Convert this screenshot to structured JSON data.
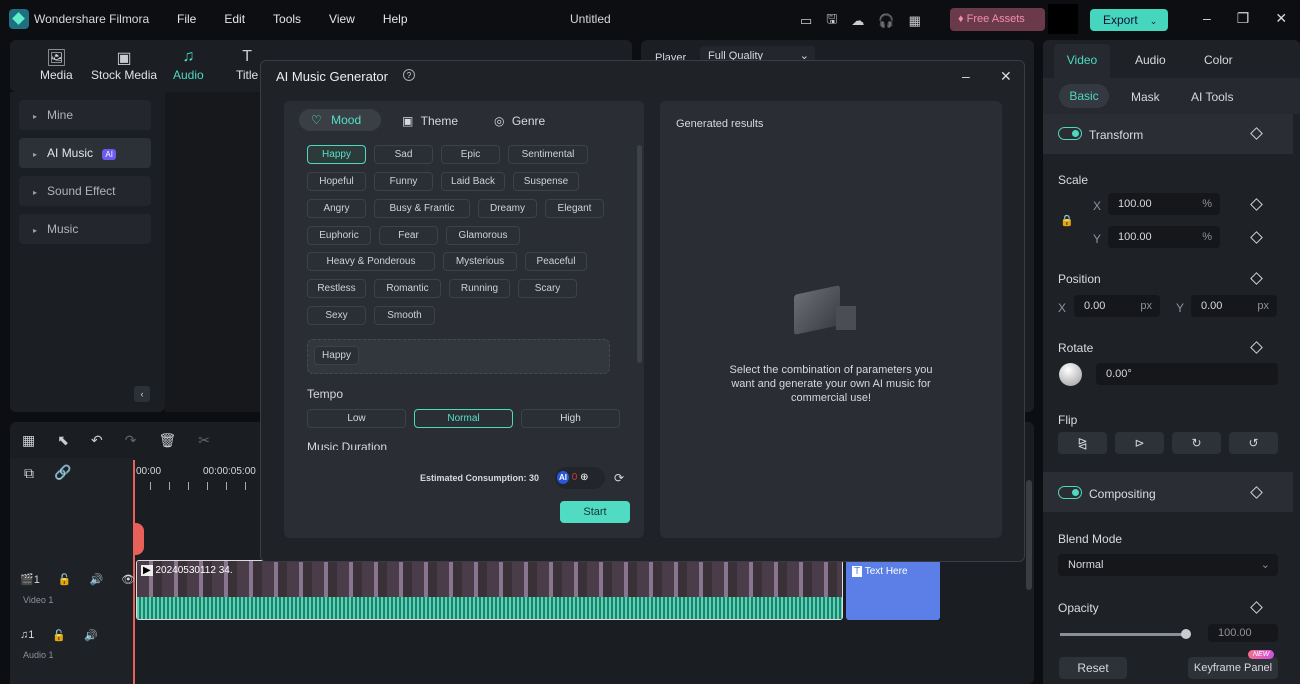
{
  "app": {
    "name": "Wondershare Filmora",
    "title": "Untitled",
    "menu": [
      "File",
      "Edit",
      "Tools",
      "View",
      "Help"
    ],
    "free_assets": "Free Assets",
    "export": "Export"
  },
  "toolbar": {
    "items": [
      "Media",
      "Stock Media",
      "Audio",
      "Title"
    ],
    "active": "Audio"
  },
  "sidebar": {
    "items": [
      "Mine",
      "AI Music",
      "Sound Effect",
      "Music"
    ],
    "ai_badge": "AI"
  },
  "player": {
    "label": "Player",
    "quality": "Full Quality"
  },
  "dialog": {
    "title": "AI Music Generator",
    "tabs": [
      "Mood",
      "Theme",
      "Genre"
    ],
    "active_tab": "Mood",
    "moods": [
      "Happy",
      "Sad",
      "Epic",
      "Sentimental",
      "Hopeful",
      "Funny",
      "Laid Back",
      "Suspense",
      "Angry",
      "Busy & Frantic",
      "Dreamy",
      "Elegant",
      "Euphoric",
      "Fear",
      "Glamorous",
      "Heavy & Ponderous",
      "Mysterious",
      "Peaceful",
      "Restless",
      "Romantic",
      "Running",
      "Scary",
      "Sexy",
      "Smooth"
    ],
    "selected_mood": "Happy",
    "selected_chip": "Happy",
    "tempo_label": "Tempo",
    "tempo": [
      "Low",
      "Normal",
      "High"
    ],
    "tempo_selected": "Normal",
    "duration_label": "Music Duration",
    "consumption": "Estimated Consumption: 30",
    "credits": "0",
    "credit_badge": "AI",
    "start": "Start",
    "results_title": "Generated results",
    "empty_text": "Select the combination of parameters you want and generate your own AI music for commercial use!"
  },
  "timeline": {
    "times": [
      "00:00",
      "00:00:05:00"
    ],
    "video_track": "Video 1",
    "audio_track": "Audio 1",
    "track_num": "1",
    "clip_name": "20240530112 34.",
    "text_clip": "Text Here"
  },
  "inspector": {
    "tabs": [
      "Video",
      "Audio",
      "Color"
    ],
    "subtabs": [
      "Basic",
      "Mask",
      "AI Tools"
    ],
    "transform": "Transform",
    "scale": "Scale",
    "scale_x": "100.00",
    "scale_y": "100.00",
    "pct": "%",
    "x": "X",
    "y": "Y",
    "position": "Position",
    "pos_x": "0.00",
    "pos_y": "0.00",
    "px": "px",
    "rotate": "Rotate",
    "rotate_val": "0.00°",
    "flip": "Flip",
    "compositing": "Compositing",
    "blend_mode": "Blend Mode",
    "blend_val": "Normal",
    "opacity": "Opacity",
    "opacity_val": "100.00",
    "opacity_level": 100,
    "reset": "Reset",
    "keyframe": "Keyframe Panel",
    "new_badge": "NEW"
  },
  "colors": {
    "accent": "#4fd8c0",
    "text_clip": "#5b7fe6",
    "playhead": "#e8605a"
  }
}
